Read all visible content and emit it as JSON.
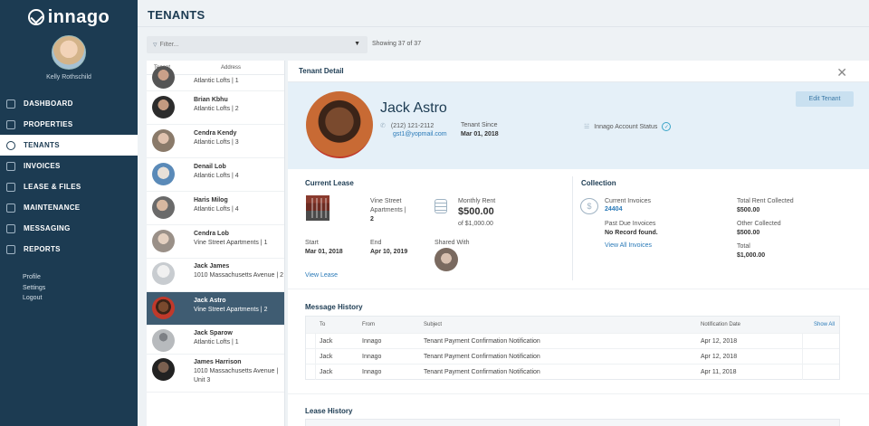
{
  "brand": {
    "name": "innago"
  },
  "user": {
    "name": "Kelly Rothschild"
  },
  "nav": [
    {
      "label": "DASHBOARD",
      "icon": "dashboard-icon",
      "active": false
    },
    {
      "label": "PROPERTIES",
      "icon": "properties-icon",
      "active": false
    },
    {
      "label": "TENANTS",
      "icon": "tenants-icon",
      "active": true
    },
    {
      "label": "INVOICES",
      "icon": "invoices-icon",
      "active": false
    },
    {
      "label": "LEASE & FILES",
      "icon": "lease-files-icon",
      "active": false
    },
    {
      "label": "MAINTENANCE",
      "icon": "maintenance-icon",
      "active": false
    },
    {
      "label": "MESSAGING",
      "icon": "messaging-icon",
      "active": false
    },
    {
      "label": "REPORTS",
      "icon": "reports-icon",
      "active": false
    }
  ],
  "sub_links": [
    "Profile",
    "Settings",
    "Logout"
  ],
  "page": {
    "title": "TENANTS"
  },
  "filter": {
    "placeholder": "Filter...",
    "showing": "Showing 37 of 37"
  },
  "list": {
    "headers": {
      "tenant": "Tenant",
      "address": "Address"
    },
    "rows": [
      {
        "name": "",
        "address": "Atlantic Lofts | 1",
        "active": false
      },
      {
        "name": "Brian Kbhu",
        "address": "Atlantic Lofts | 2",
        "active": false
      },
      {
        "name": "Cendra Kendy",
        "address": "Atlantic Lofts | 3",
        "active": false
      },
      {
        "name": "Denail Lob",
        "address": "Atlantic Lofts | 4",
        "active": false
      },
      {
        "name": "Haris Milog",
        "address": "Atlantic Lofts | 4",
        "active": false
      },
      {
        "name": "Cendra Lob",
        "address": "Vine Street Apartments | 1",
        "active": false
      },
      {
        "name": "Jack James",
        "address": "1010 Massachusetts Avenue | 2",
        "active": false
      },
      {
        "name": "Jack Astro",
        "address": "Vine Street Apartments | 2",
        "active": true
      },
      {
        "name": "Jack Sparow",
        "address": "Atlantic Lofts | 1",
        "active": false
      },
      {
        "name": "James Harrison",
        "address": "1010 Massachusetts Avenue | Unit 3",
        "active": false
      }
    ]
  },
  "detail": {
    "title": "Tenant Detail",
    "name": "Jack Astro",
    "phone": "(212) 121-2112",
    "email": "gst1@yopmail.com",
    "since_label": "Tenant Since",
    "since_value": "Mar 01, 2018",
    "account_status_label": "Innago Account Status",
    "edit_label": "Edit Tenant",
    "current_lease": {
      "title": "Current Lease",
      "property": "Vine Street Apartments |",
      "unit": "2",
      "rent_label": "Monthly Rent",
      "rent_value": "$500.00",
      "rent_of": "of $1,000.00",
      "start_label": "Start",
      "start_value": "Mar 01, 2018",
      "end_label": "End",
      "end_value": "Apr 10, 2019",
      "shared_label": "Shared With",
      "view_lease": "View Lease"
    },
    "collection": {
      "title": "Collection",
      "current_invoices_label": "Current Invoices",
      "current_invoices_value": "24404",
      "past_due_label": "Past Due Invoices",
      "past_due_value": "No Record found.",
      "view_all": "View All Invoices",
      "total_rent_label": "Total Rent Collected",
      "total_rent_value": "$500.00",
      "other_label": "Other Collected",
      "other_value": "$500.00",
      "total_label": "Total",
      "total_value": "$1,000.00"
    },
    "message_history": {
      "title": "Message History",
      "columns": {
        "to": "To",
        "from": "From",
        "subject": "Subject",
        "date": "Notification Date",
        "show_all": "Show All"
      },
      "rows": [
        {
          "to": "Jack",
          "from": "Innago",
          "subject": "Tenant Payment Confirmation Notification",
          "date": "Apr 12, 2018"
        },
        {
          "to": "Jack",
          "from": "Innago",
          "subject": "Tenant Payment Confirmation Notification",
          "date": "Apr 12, 2018"
        },
        {
          "to": "Jack",
          "from": "Innago",
          "subject": "Tenant Payment Confirmation Notification",
          "date": "Apr 11, 2018"
        }
      ]
    },
    "lease_history": {
      "title": "Lease History"
    }
  }
}
